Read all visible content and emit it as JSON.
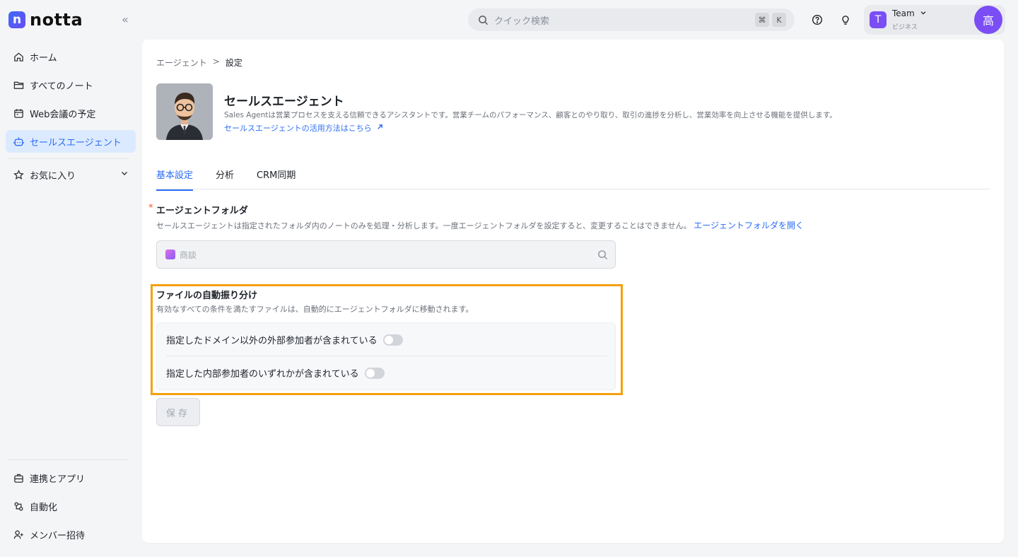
{
  "app": {
    "logo_letter": "n",
    "logo_text": "notta"
  },
  "sidebar": {
    "items": [
      {
        "label": "ホーム",
        "icon": "home-icon"
      },
      {
        "label": "すべてのノート",
        "icon": "folder-icon"
      },
      {
        "label": "Web会議の予定",
        "icon": "calendar-icon"
      },
      {
        "label": "セールスエージェント",
        "icon": "robot-icon",
        "active": true
      },
      {
        "label": "お気に入り",
        "icon": "star-icon"
      }
    ],
    "bottom_items": [
      {
        "label": "連携とアプリ",
        "icon": "integration-icon"
      },
      {
        "label": "自動化",
        "icon": "automation-icon"
      },
      {
        "label": "メンバー招待",
        "icon": "invite-icon"
      }
    ]
  },
  "topbar": {
    "search_placeholder": "クイック検索",
    "shortcut_keys": [
      "⌘",
      "K"
    ],
    "team": {
      "avatar_letter": "T",
      "name": "Team",
      "plan": "ビジネス"
    },
    "user_avatar": "高"
  },
  "main": {
    "breadcrumb": [
      "エージェント",
      ">",
      "設定"
    ],
    "agent": {
      "title": "セールスエージェント",
      "description": "Sales Agentは営業プロセスを支える信頼できるアシスタントです。営業チームのパフォーマンス、顧客とのやり取り、取引の進捗を分析し、営業効率を向上させる機能を提供します。",
      "link": "セールスエージェントの活用方法はこちら"
    },
    "tabs": [
      "基本設定",
      "分析",
      "CRM同期"
    ],
    "active_tab": 0,
    "folder": {
      "required_mark": "*",
      "label": "エージェントフォルダ",
      "help": "セールスエージェントは指定されたフォルダ内のノートのみを処理・分析します。一度エージェントフォルダを設定すると、変更することはできません。",
      "help_link": "エージェントフォルダを開く",
      "value": "商談"
    },
    "auto_sort": {
      "title": "ファイルの自動振り分け",
      "help": "有効なすべての条件を満たすファイルは、自動的にエージェントフォルダに移動されます。",
      "rules": [
        {
          "label": "指定したドメイン以外の外部参加者が含まれている",
          "enabled": false
        },
        {
          "label": "指定した内部参加者のいずれかが含まれている",
          "enabled": false
        }
      ]
    },
    "save_label": "保存"
  },
  "colors": {
    "accent": "#2b6ef5",
    "highlight": "#f5a00e",
    "avatar": "#7a4df5"
  }
}
